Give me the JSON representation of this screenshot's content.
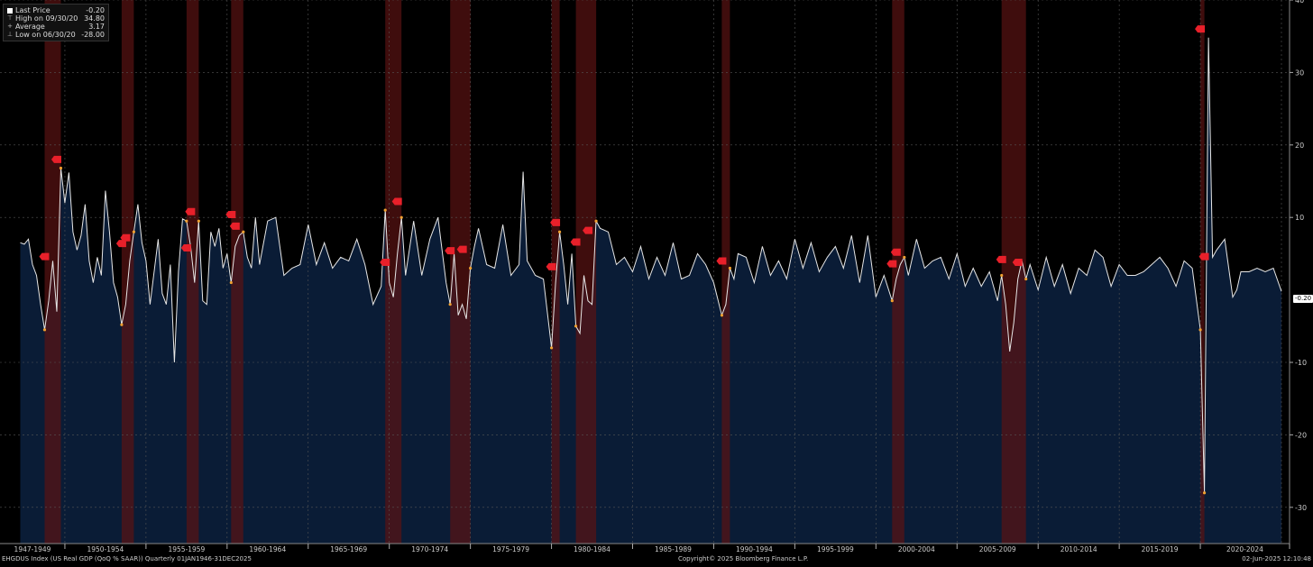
{
  "legend": {
    "items": [
      {
        "glyph": "box",
        "label": "Last Price",
        "value": "-0.20"
      },
      {
        "glyph": "⊤",
        "label": "High on 09/30/20",
        "value": "34.80"
      },
      {
        "glyph": "+",
        "label": "Average",
        "value": "3.17"
      },
      {
        "glyph": "⊥",
        "label": "Low on 06/30/20",
        "value": "-28.00"
      }
    ]
  },
  "last_value_badge": "-0.20",
  "footer": {
    "left": "EHGDUS Index (US Real GDP (QoQ % SAAR))  Quarterly 01JAN1946-31DEC2025",
    "center": "Copyright© 2025 Bloomberg Finance L.P.",
    "right": "02-Jun-2025 12:10:48"
  },
  "colors": {
    "background": "#000000",
    "area_fill": "#0a1c36",
    "line": "#e6e6e6",
    "recession_band": "#5a1212",
    "recession_marker": "#e8202a",
    "point_marker": "#f0a030"
  },
  "chart_data": {
    "type": "area",
    "title": "",
    "xlabel": "",
    "ylabel": "",
    "ylim": [
      -35,
      40
    ],
    "y_ticks": [
      40,
      30,
      20,
      10,
      -10,
      -20,
      -30
    ],
    "x_range": [
      1946,
      2025.5
    ],
    "x_tick_labels": [
      "1947-1949",
      "1950-1954",
      "1955-1959",
      "1960-1964",
      "1965-1969",
      "1970-1974",
      "1975-1979",
      "1980-1984",
      "1985-1989",
      "1990-1994",
      "1995-1999",
      "2000-2004",
      "2005-2009",
      "2010-2014",
      "2015-2019",
      "2020-2024"
    ],
    "grid": true,
    "legend_position": "top-left",
    "recession_bands": [
      [
        1948.75,
        1949.75
      ],
      [
        1953.5,
        1954.25
      ],
      [
        1957.5,
        1958.25
      ],
      [
        1960.25,
        1961.0
      ],
      [
        1969.75,
        1970.75
      ],
      [
        1973.75,
        1975.0
      ],
      [
        1980.0,
        1980.5
      ],
      [
        1981.5,
        1982.75
      ],
      [
        1990.5,
        1991.0
      ],
      [
        2001.0,
        2001.75
      ],
      [
        2007.75,
        2009.25
      ],
      [
        2020.0,
        2020.25
      ]
    ],
    "series": [
      {
        "name": "EHGDUS Index",
        "x": [
          1947.25,
          1947.5,
          1947.75,
          1948.0,
          1948.25,
          1948.5,
          1948.75,
          1949.0,
          1949.25,
          1949.5,
          1949.75,
          1950.0,
          1950.25,
          1950.5,
          1950.75,
          1951.0,
          1951.25,
          1951.5,
          1951.75,
          1952.0,
          1952.25,
          1952.5,
          1952.75,
          1953.0,
          1953.25,
          1953.5,
          1953.75,
          1954.0,
          1954.25,
          1954.5,
          1954.75,
          1955.0,
          1955.25,
          1955.5,
          1955.75,
          1956.0,
          1956.25,
          1956.5,
          1956.75,
          1957.0,
          1957.25,
          1957.5,
          1957.75,
          1958.0,
          1958.25,
          1958.5,
          1958.75,
          1959.0,
          1959.25,
          1959.5,
          1959.75,
          1960.0,
          1960.25,
          1960.5,
          1960.75,
          1961.0,
          1961.25,
          1961.5,
          1961.75,
          1962.0,
          1962.5,
          1963.0,
          1963.5,
          1964.0,
          1964.5,
          1965.0,
          1965.5,
          1966.0,
          1966.5,
          1967.0,
          1967.5,
          1968.0,
          1968.5,
          1969.0,
          1969.5,
          1969.75,
          1970.0,
          1970.25,
          1970.5,
          1970.75,
          1971.0,
          1971.5,
          1972.0,
          1972.5,
          1973.0,
          1973.5,
          1973.75,
          1974.0,
          1974.25,
          1974.5,
          1974.75,
          1975.0,
          1975.25,
          1975.5,
          1976.0,
          1976.5,
          1977.0,
          1977.5,
          1978.0,
          1978.25,
          1978.5,
          1979.0,
          1979.5,
          1980.0,
          1980.25,
          1980.5,
          1980.75,
          1981.0,
          1981.25,
          1981.5,
          1981.75,
          1982.0,
          1982.25,
          1982.5,
          1982.75,
          1983.0,
          1983.5,
          1984.0,
          1984.5,
          1985.0,
          1985.5,
          1986.0,
          1986.5,
          1987.0,
          1987.5,
          1988.0,
          1988.5,
          1989.0,
          1989.5,
          1990.0,
          1990.5,
          1990.75,
          1991.0,
          1991.25,
          1991.5,
          1992.0,
          1992.5,
          1993.0,
          1993.5,
          1994.0,
          1994.5,
          1995.0,
          1995.5,
          1996.0,
          1996.5,
          1997.0,
          1997.5,
          1998.0,
          1998.5,
          1999.0,
          1999.5,
          2000.0,
          2000.5,
          2001.0,
          2001.25,
          2001.5,
          2001.75,
          2002.0,
          2002.5,
          2003.0,
          2003.5,
          2004.0,
          2004.5,
          2005.0,
          2005.5,
          2006.0,
          2006.5,
          2007.0,
          2007.5,
          2007.75,
          2008.0,
          2008.25,
          2008.5,
          2008.75,
          2009.0,
          2009.25,
          2009.5,
          2010.0,
          2010.5,
          2011.0,
          2011.5,
          2012.0,
          2012.5,
          2013.0,
          2013.5,
          2014.0,
          2014.5,
          2015.0,
          2015.5,
          2016.0,
          2016.5,
          2017.0,
          2017.5,
          2018.0,
          2018.5,
          2019.0,
          2019.5,
          2020.0,
          2020.25,
          2020.5,
          2020.75,
          2021.0,
          2021.5,
          2022.0,
          2022.25,
          2022.5,
          2023.0,
          2023.5,
          2024.0,
          2024.5,
          2025.0
        ],
        "y": [
          6.5,
          6.3,
          7.0,
          3.5,
          2.0,
          -2.0,
          -5.5,
          -1.5,
          4.0,
          -3.0,
          16.8,
          12.0,
          16.2,
          8.0,
          5.5,
          7.5,
          11.8,
          4.0,
          1.0,
          4.5,
          2.0,
          13.7,
          8.0,
          1.0,
          -1.0,
          -4.8,
          -2.0,
          4.0,
          8.0,
          11.8,
          6.5,
          4.0,
          -2.0,
          2.5,
          7.0,
          -0.5,
          -2.0,
          3.5,
          -10.0,
          2.5,
          9.8,
          9.5,
          6.0,
          1.0,
          9.5,
          -1.5,
          -2.0,
          8.0,
          6.0,
          8.5,
          3.0,
          5.0,
          1.0,
          6.0,
          7.5,
          8.0,
          4.5,
          3.0,
          10.0,
          3.5,
          9.5,
          10.0,
          2.0,
          3.0,
          3.5,
          9.0,
          3.5,
          6.5,
          3.0,
          4.5,
          4.0,
          7.0,
          3.5,
          -2.0,
          0.5,
          11.0,
          1.0,
          -1.0,
          5.0,
          10.0,
          2.0,
          9.5,
          2.0,
          7.0,
          10.0,
          1.0,
          -2.0,
          5.0,
          -3.5,
          -2.0,
          -4.0,
          3.0,
          6.0,
          8.5,
          3.5,
          3.0,
          9.0,
          2.0,
          3.5,
          16.3,
          4.0,
          2.0,
          1.5,
          -8.0,
          1.0,
          8.0,
          3.5,
          -2.0,
          5.0,
          -5.0,
          -6.0,
          2.0,
          -1.5,
          -2.0,
          9.5,
          8.5,
          8.0,
          3.5,
          4.5,
          2.5,
          6.0,
          1.5,
          4.5,
          2.0,
          6.5,
          1.5,
          2.0,
          5.0,
          3.5,
          1.0,
          -3.5,
          -2.0,
          3.0,
          1.5,
          5.0,
          4.5,
          1.0,
          6.0,
          2.0,
          4.0,
          1.5,
          7.0,
          3.0,
          6.5,
          2.5,
          4.5,
          6.0,
          3.0,
          7.5,
          1.0,
          7.5,
          -1.0,
          2.0,
          -1.5,
          1.5,
          3.5,
          4.5,
          2.0,
          7.0,
          3.0,
          4.0,
          4.5,
          1.5,
          5.0,
          0.5,
          3.0,
          0.5,
          2.5,
          -1.5,
          2.0,
          -2.0,
          -8.5,
          -4.5,
          1.5,
          4.0,
          1.5,
          3.5,
          0.0,
          4.5,
          0.5,
          3.5,
          -0.5,
          3.0,
          2.0,
          5.5,
          4.5,
          0.5,
          3.5,
          2.0,
          2.0,
          2.5,
          3.5,
          4.5,
          3.0,
          0.5,
          4.0,
          3.0,
          -5.5,
          -28.0,
          34.8,
          4.5,
          5.5,
          7.0,
          -1.0,
          0.0,
          2.5,
          2.5,
          3.0,
          2.5,
          3.0,
          -0.2
        ]
      }
    ],
    "recession_marker_labels": [
      {
        "x": 1948.75,
        "y": 4.6
      },
      {
        "x": 1949.5,
        "y": 18.0
      },
      {
        "x": 1953.5,
        "y": 6.4
      },
      {
        "x": 1953.75,
        "y": 7.2
      },
      {
        "x": 1957.5,
        "y": 5.8
      },
      {
        "x": 1957.75,
        "y": 10.8
      },
      {
        "x": 1960.25,
        "y": 10.4
      },
      {
        "x": 1960.5,
        "y": 8.8
      },
      {
        "x": 1969.75,
        "y": 3.8
      },
      {
        "x": 1970.5,
        "y": 12.2
      },
      {
        "x": 1973.75,
        "y": 5.4
      },
      {
        "x": 1974.5,
        "y": 5.6
      },
      {
        "x": 1980.0,
        "y": 3.2
      },
      {
        "x": 1980.25,
        "y": 9.3
      },
      {
        "x": 1981.5,
        "y": 6.6
      },
      {
        "x": 1982.25,
        "y": 8.2
      },
      {
        "x": 1990.5,
        "y": 4.0
      },
      {
        "x": 2001.0,
        "y": 3.6
      },
      {
        "x": 2001.25,
        "y": 5.2
      },
      {
        "x": 2007.75,
        "y": 4.2
      },
      {
        "x": 2008.75,
        "y": 3.8
      },
      {
        "x": 2020.0,
        "y": 36.0
      },
      {
        "x": 2020.25,
        "y": 4.6
      }
    ]
  }
}
